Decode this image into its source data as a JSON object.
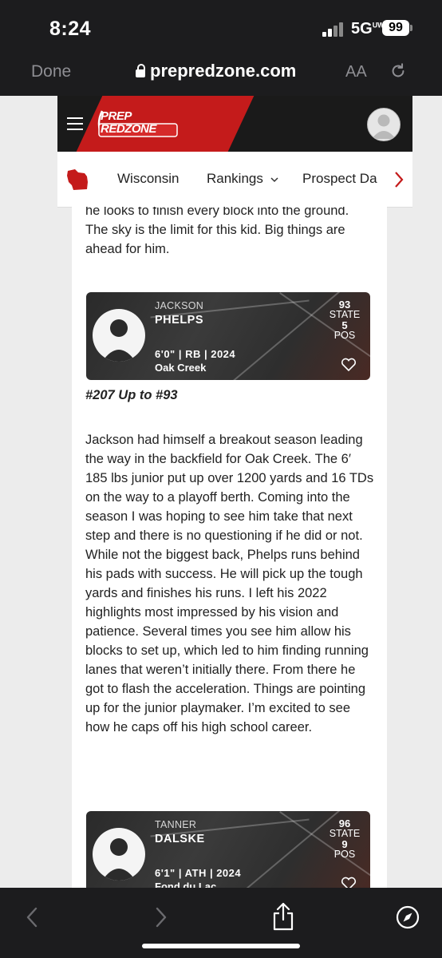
{
  "status_bar": {
    "time": "8:24",
    "network": "5G",
    "network_sup": "UW",
    "battery": "99"
  },
  "browser": {
    "done_label": "Done",
    "url": "prepredzone.com",
    "text_size_label": "AA"
  },
  "site": {
    "logo_line1": "PREP",
    "logo_line2": "REDZONE",
    "nav": [
      "Wisconsin",
      "Rankings",
      "Prospect Da"
    ],
    "accent_color": "#c41b1b"
  },
  "article": {
    "intro_text": "he looks to finish every block into the ground. The sky is the limit for this kid. Big things are ahead for him.",
    "players": [
      {
        "first_name": "JACKSON",
        "last_name": "PHELPS",
        "info": "6'0\" | RB | 2024",
        "school": "Oak Creek",
        "state_rank": "93",
        "state_label": "STATE",
        "pos_rank": "5",
        "pos_label": "POS"
      },
      {
        "first_name": "TANNER",
        "last_name": "DALSKE",
        "info": "6'1\" | ATH | 2024",
        "school": "Fond du Lac",
        "state_rank": "96",
        "state_label": "STATE",
        "pos_rank": "9",
        "pos_label": "POS"
      }
    ],
    "rank_change": "#207 Up to #93",
    "body_text": "Jackson had himself a breakout season leading the way in the backfield for Oak Creek. The 6′ 185 lbs junior put up over 1200 yards and 16 TDs on the way to a playoff berth. Coming into the season I was hoping to see him take that next step and there is no questioning if he did or not. While not the biggest back, Phelps runs behind his pads with success. He will pick up the tough yards and finishes his runs. I left his 2022 highlights most impressed by his vision and patience. Several times you see him allow his blocks to set up, which led to him finding running lanes that weren’t initially there. From there he got to flash the acceleration. Things are pointing up for the junior playmaker. I’m excited to see how he caps off his high school career."
  }
}
